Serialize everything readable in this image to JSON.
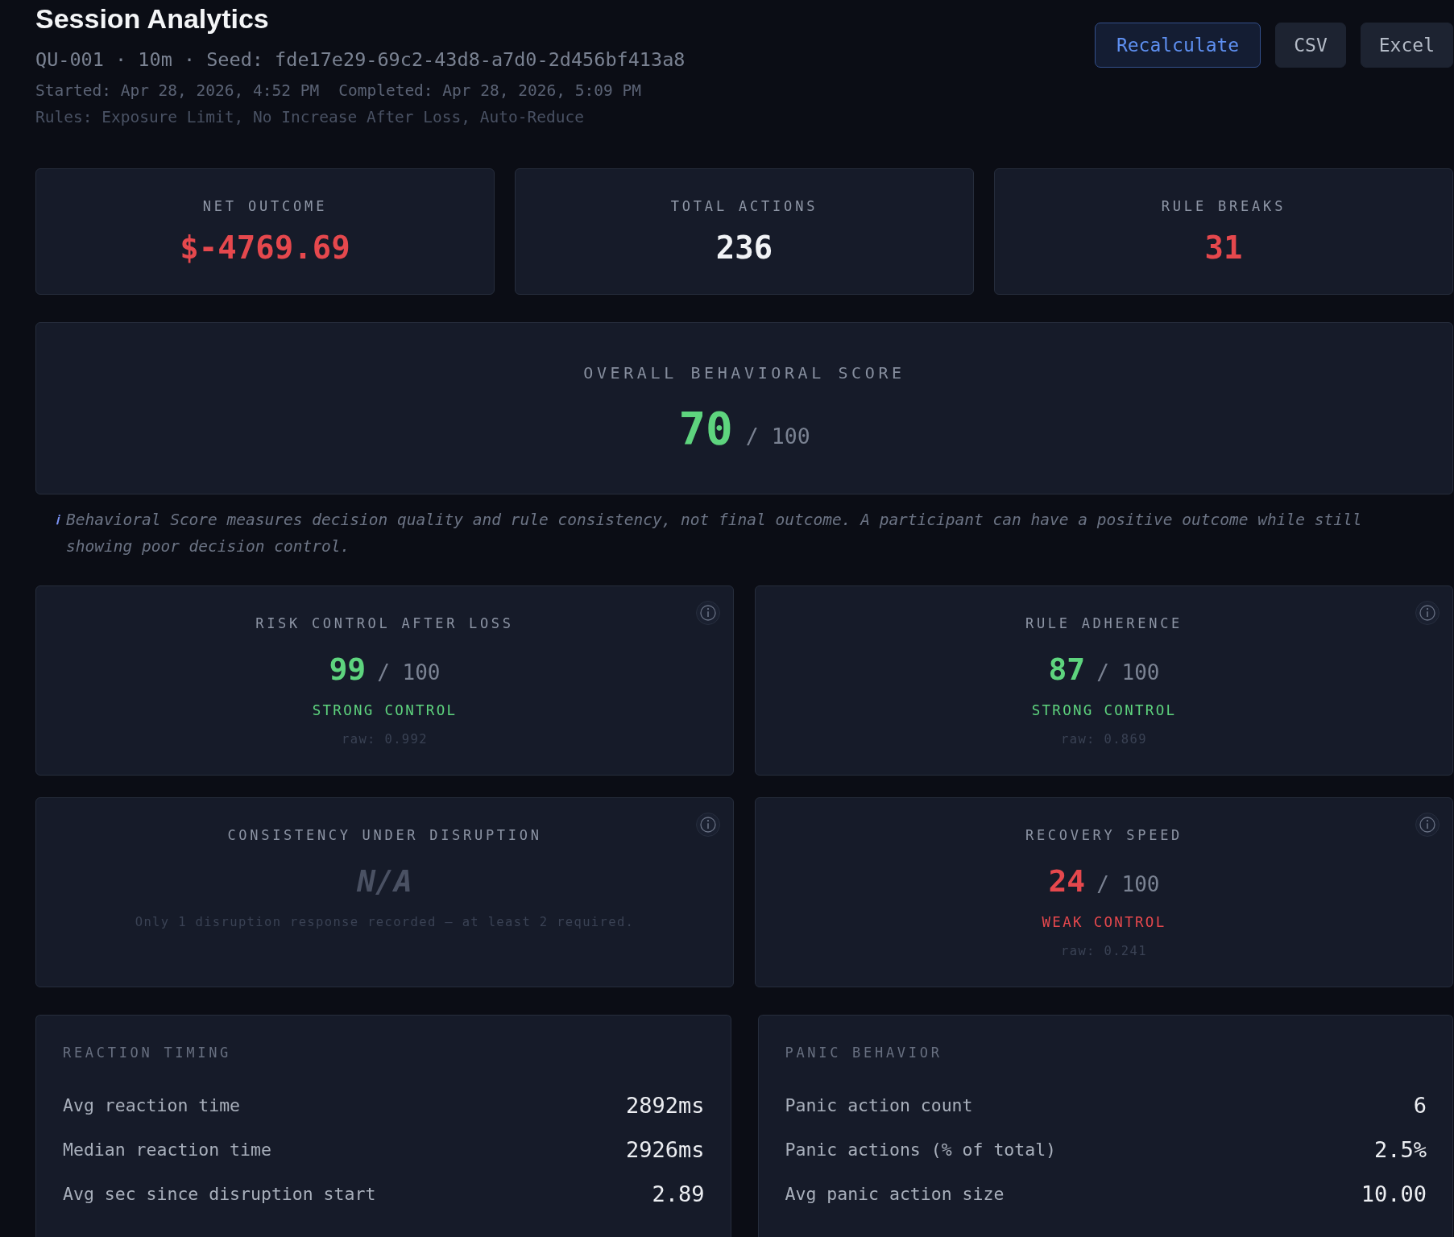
{
  "header": {
    "title": "Session Analytics",
    "session_info": "QU-001 · 10m · Seed: fde17e29-69c2-43d8-a7d0-2d456bf413a8",
    "started": "Started: Apr 28, 2026, 4:52 PM",
    "completed": "Completed: Apr 28, 2026, 5:09 PM",
    "rules": "Rules: Exposure Limit, No Increase After Loss, Auto-Reduce"
  },
  "actions": [
    {
      "label": "Recalculate",
      "kind": "primary"
    },
    {
      "label": "CSV",
      "kind": "secondary"
    },
    {
      "label": "Excel",
      "kind": "secondary"
    }
  ],
  "summary_cards": [
    {
      "label": "NET OUTCOME",
      "value": "$-4769.69",
      "color": "#e5484d"
    },
    {
      "label": "TOTAL ACTIONS",
      "value": "236",
      "color": "#f1f3f6"
    },
    {
      "label": "RULE BREAKS",
      "value": "31",
      "color": "#e5484d"
    }
  ],
  "overall_score": {
    "label": "OVERALL BEHAVIORAL SCORE",
    "value": "70",
    "scale": "/ 100"
  },
  "note": {
    "icon": "ℹ",
    "text": "Behavioral Score measures decision quality and rule consistency, not final outcome. A participant can have a positive outcome while still showing poor decision control."
  },
  "metrics": [
    {
      "kind": "score",
      "title": "RISK CONTROL AFTER LOSS",
      "value": "99",
      "scale": "/ 100",
      "verdict": "STRONG CONTROL",
      "raw": "raw: 0.992",
      "color": "#5ed47e"
    },
    {
      "kind": "score",
      "title": "RULE ADHERENCE",
      "value": "87",
      "scale": "/ 100",
      "verdict": "STRONG CONTROL",
      "raw": "raw: 0.869",
      "color": "#5ed47e"
    },
    {
      "kind": "unavailable",
      "title": "CONSISTENCY UNDER DISRUPTION",
      "value": "N/A",
      "message": "Only 1 disruption response recorded — at least 2 required."
    },
    {
      "kind": "score",
      "title": "RECOVERY SPEED",
      "value": "24",
      "scale": "/ 100",
      "verdict": "WEAK CONTROL",
      "raw": "raw: 0.241",
      "color": "#e5484d"
    }
  ],
  "panels": [
    {
      "title": "REACTION TIMING",
      "rows": [
        {
          "label": "Avg reaction time",
          "value": "2892ms"
        },
        {
          "label": "Median reaction time",
          "value": "2926ms"
        },
        {
          "label": "Avg sec since disruption start",
          "value": "2.89"
        }
      ]
    },
    {
      "title": "PANIC BEHAVIOR",
      "rows": [
        {
          "label": "Panic action count",
          "value": "6"
        },
        {
          "label": "Panic actions (% of total)",
          "value": "2.5%"
        },
        {
          "label": "Avg panic action size",
          "value": "10.00"
        }
      ]
    }
  ]
}
